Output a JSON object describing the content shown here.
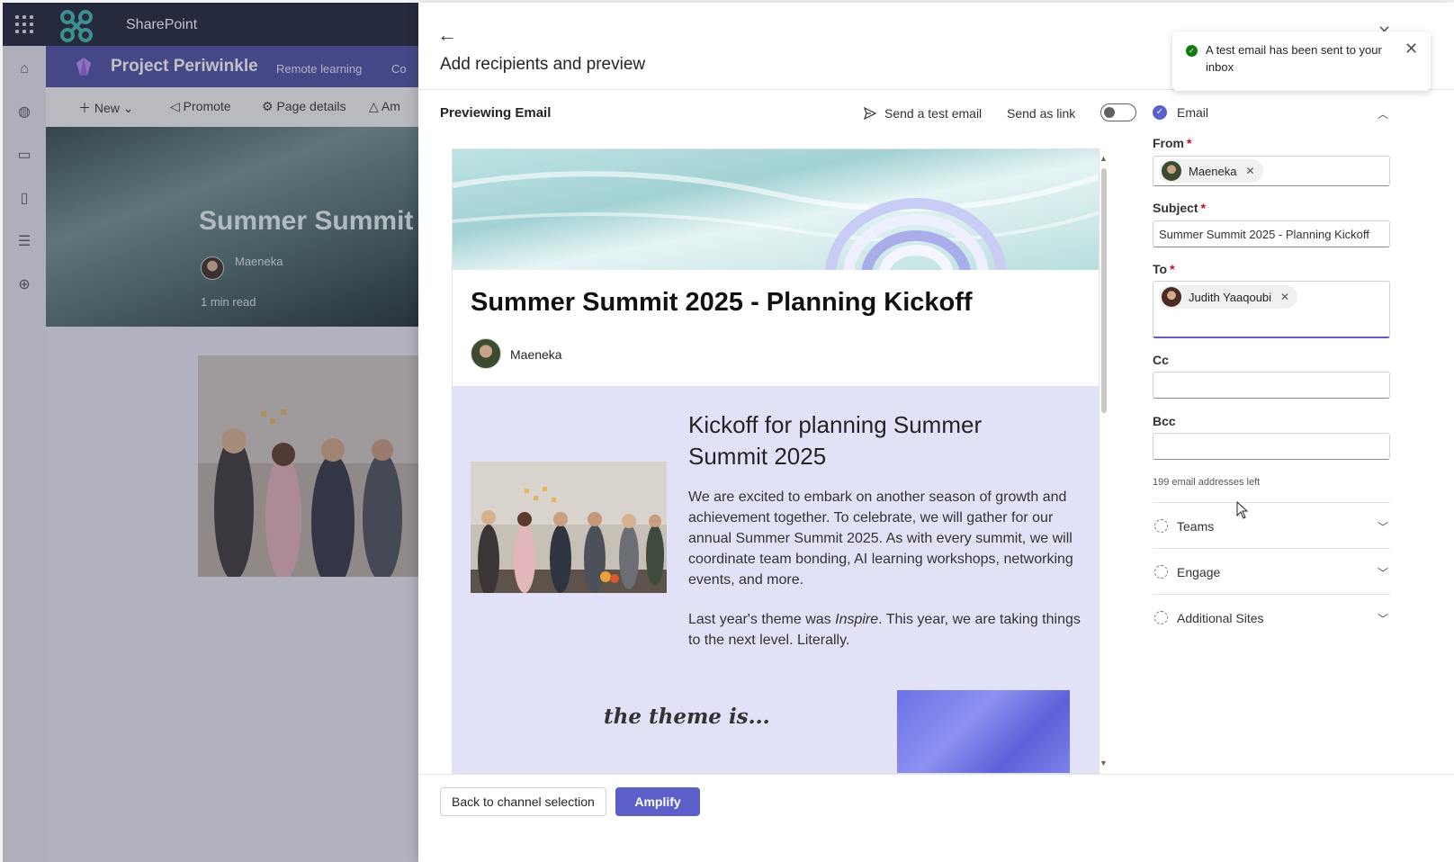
{
  "background_page": {
    "suite": {
      "brand": "SharePoint"
    },
    "site": {
      "title": "Project Periwinkle",
      "nav": [
        "Remote learning",
        "Co"
      ]
    },
    "command_bar": {
      "new": "New",
      "promote": "Promote",
      "page_details": "Page details",
      "amplify_partial": "Am"
    },
    "hero": {
      "title": "Summer Summit",
      "author": "Maeneka",
      "read_time": "1 min read"
    }
  },
  "panel": {
    "title": "Add recipients and preview",
    "previewing_label": "Previewing Email",
    "send_test_label": "Send a test email",
    "send_as_link_label": "Send as link",
    "send_as_link_on": false,
    "email": {
      "title": "Summer Summit 2025 - Planning Kickoff",
      "author": "Maeneka",
      "section_title": "Kickoff for planning Summer Summit 2025",
      "paragraph1": "We are excited to embark on another season of growth and achievement together. To celebrate, we will gather for our annual Summer Summit 2025. As with every summit, we will coordinate team bonding, AI learning workshops, networking events, and more.",
      "paragraph2_prefix": "Last year's theme was ",
      "paragraph2_emphasis": "Inspire",
      "paragraph2_suffix": ". This year, we are taking things to the next level. Literally.",
      "theme_text": "the theme is..."
    },
    "footer": {
      "back_label": "Back to channel selection",
      "amplify_label": "Amplify"
    }
  },
  "form": {
    "email_section": "Email",
    "from_label": "From",
    "from_value": "Maeneka",
    "subject_label": "Subject",
    "subject_value": "Summer Summit 2025 - Planning Kickoff",
    "to_label": "To",
    "to_value": "Judith Yaaqoubi",
    "cc_label": "Cc",
    "bcc_label": "Bcc",
    "addresses_left": "199 email addresses left",
    "sections": [
      "Teams",
      "Engage",
      "Additional Sites"
    ]
  },
  "toast": {
    "message": "A test email has been sent to your inbox"
  },
  "colors": {
    "accent": "#5b5fc7",
    "site_header": "#4b4f9f",
    "email_body_bg": "#e1e2f7",
    "success": "#107c10",
    "required": "#c50f1f"
  }
}
